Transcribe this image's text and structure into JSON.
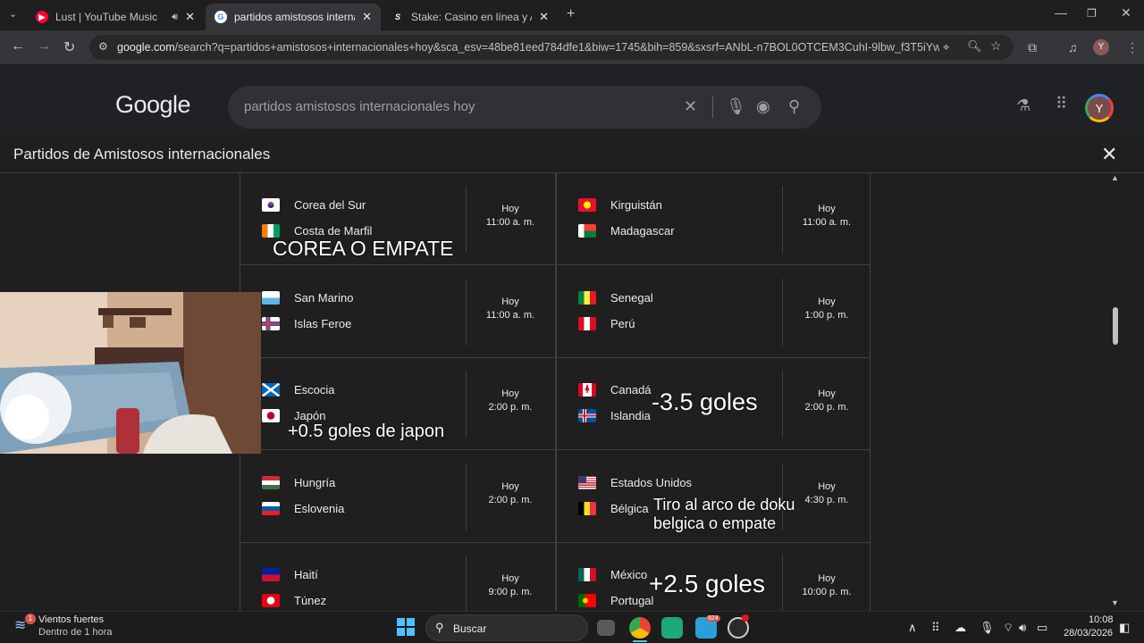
{
  "browser": {
    "tabs": [
      {
        "title": "Lust | YouTube Music",
        "favicon_color": "#ff0033"
      },
      {
        "title": "partidos amistosos internaciona",
        "favicon_color": "#4285f4"
      },
      {
        "title": "Stake: Casino en línea y Apuest",
        "favicon_color": "#ffffff"
      }
    ],
    "new_tab": "+",
    "url_host": "google.com",
    "url_rest": "/search?q=partidos+amistosos+internacionales+hoy&sca_esv=48be81eed784dfe1&biw=1745&bih=859&sxsrf=ANbL-n7BOL0OTCEM3CuhI-9lbw_f3T5iYw%3A1774...",
    "profile_initial": "Y"
  },
  "google": {
    "logo": "Google",
    "query": "partidos amistosos internacionales hoy",
    "avatar_initial": "Y"
  },
  "panel": {
    "title": "Partidos de Amistosos internacionales",
    "matches": [
      {
        "team1": "Corea del Sur",
        "team2": "Costa de Marfil",
        "day": "Hoy",
        "time": "11:00 a. m.",
        "flag1": "kor",
        "flag2": "civ"
      },
      {
        "team1": "Kirguistán",
        "team2": "Madagascar",
        "day": "Hoy",
        "time": "11:00 a. m.",
        "flag1": "kgz",
        "flag2": "mdg"
      },
      {
        "team1": "San Marino",
        "team2": "Islas Feroe",
        "day": "Hoy",
        "time": "11:00 a. m.",
        "flag1": "smr",
        "flag2": "fro"
      },
      {
        "team1": "Senegal",
        "team2": "Perú",
        "day": "Hoy",
        "time": "1:00 p. m.",
        "flag1": "sen",
        "flag2": "per"
      },
      {
        "team1": "Escocia",
        "team2": "Japón",
        "day": "Hoy",
        "time": "2:00 p. m.",
        "flag1": "sco",
        "flag2": "jpn"
      },
      {
        "team1": "Canadá",
        "team2": "Islandia",
        "day": "Hoy",
        "time": "2:00 p. m.",
        "flag1": "can",
        "flag2": "isl"
      },
      {
        "team1": "Hungría",
        "team2": "Eslovenia",
        "day": "Hoy",
        "time": "2:00 p. m.",
        "flag1": "hun",
        "flag2": "svn"
      },
      {
        "team1": "Estados Unidos",
        "team2": "Bélgica",
        "day": "Hoy",
        "time": "4:30 p. m.",
        "flag1": "usa",
        "flag2": "bel"
      },
      {
        "team1": "Haití",
        "team2": "Túnez",
        "day": "Hoy",
        "time": "9:00 p. m.",
        "flag1": "hti",
        "flag2": "tun"
      },
      {
        "team1": "México",
        "team2": "Portugal",
        "day": "Hoy",
        "time": "10:00 p. m.",
        "flag1": "mex",
        "flag2": "por"
      }
    ]
  },
  "annotations": {
    "corea": "COREA O EMPATE",
    "japon": "+0.5 goles de japon",
    "canada": "-3.5 goles",
    "belgica_line1": "Tiro al arco de doku",
    "belgica_line2": "belgica o empate",
    "mexico": "+2.5 goles"
  },
  "taskbar": {
    "weather_title": "Vientos fuertes",
    "weather_sub": "Dentro de 1 hora",
    "weather_badge": "1",
    "search_label": "Buscar",
    "telegram_badge": "824",
    "time": "10:08",
    "date": "28/03/2026"
  }
}
